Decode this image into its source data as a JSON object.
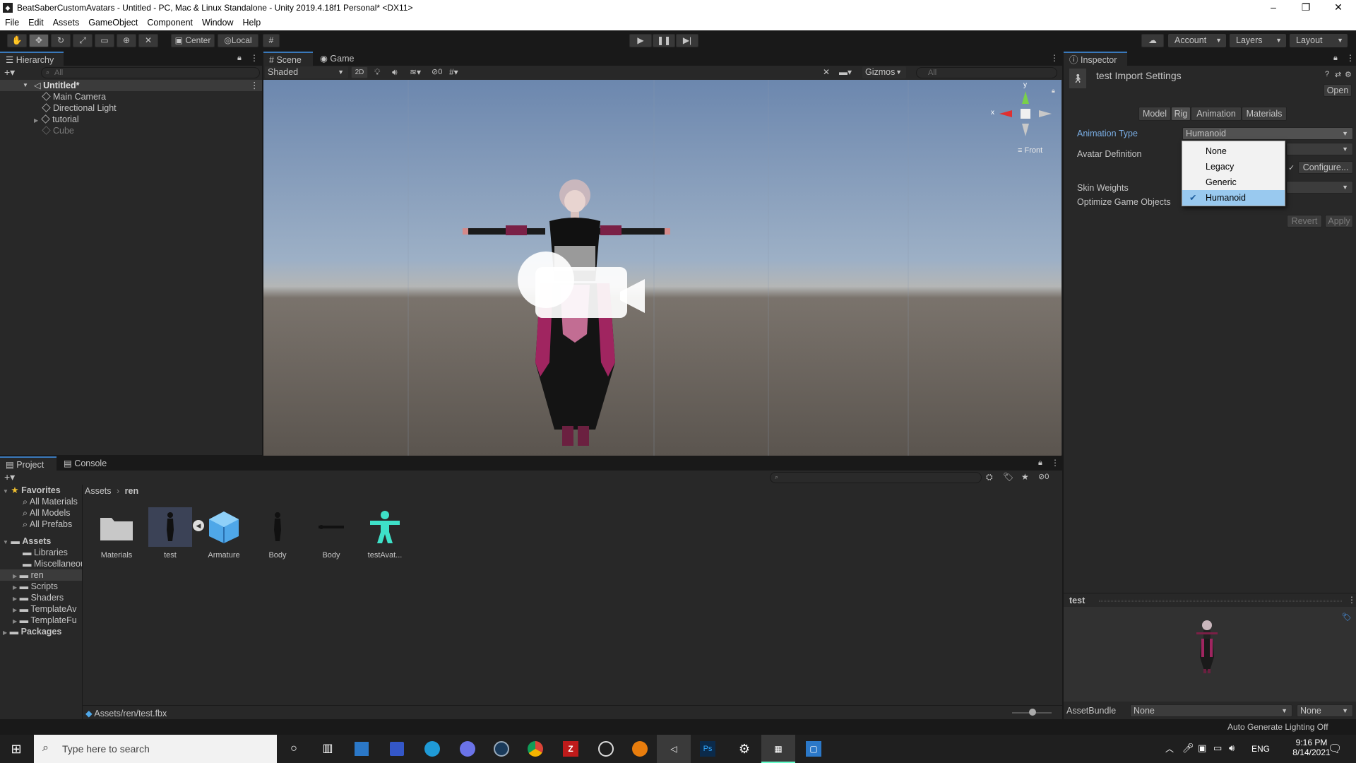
{
  "window": {
    "title": "BeatSaberCustomAvatars - Untitled - PC, Mac & Linux Standalone - Unity 2019.4.18f1 Personal* <DX11>",
    "minimize": "–",
    "restore": "❐",
    "close": "✕"
  },
  "menu": [
    "File",
    "Edit",
    "Assets",
    "GameObject",
    "Component",
    "Window",
    "Help"
  ],
  "toolbar": {
    "pivot": "Center",
    "space": "Local",
    "account": "Account",
    "layers": "Layers",
    "layout": "Layout"
  },
  "hierarchy": {
    "tab": "Hierarchy",
    "search_placeholder": "All",
    "scene": "Untitled*",
    "items": [
      {
        "label": "Main Camera",
        "active": true
      },
      {
        "label": "Directional Light",
        "active": true
      },
      {
        "label": "tutorial",
        "active": true
      },
      {
        "label": "Cube",
        "active": false
      }
    ]
  },
  "scene_view": {
    "tabs": [
      "Scene",
      "Game"
    ],
    "shading": "Shaded",
    "mode_2d": "2D",
    "hidden_count": "0",
    "gizmos": "Gizmos",
    "search_placeholder": "All",
    "gizmo_axis_y": "y",
    "gizmo_axis_x": "x",
    "view_label": "Front"
  },
  "inspector": {
    "tab": "Inspector",
    "title": "test Import Settings",
    "open": "Open",
    "subtabs": [
      "Model",
      "Rig",
      "Animation",
      "Materials"
    ],
    "active_subtab": "Rig",
    "fields": {
      "animation_type_label": "Animation Type",
      "animation_type_value": "Humanoid",
      "avatar_definition_label": "Avatar Definition",
      "configure": "Configure...",
      "skin_weights_label": "Skin Weights",
      "optimize_label": "Optimize Game Objects"
    },
    "dropdown_options": [
      "None",
      "Legacy",
      "Generic",
      "Humanoid"
    ],
    "dropdown_selected": "Humanoid",
    "revert": "Revert",
    "apply": "Apply",
    "preview_title": "test",
    "assetbundle_label": "AssetBundle",
    "assetbundle_value": "None",
    "assetbundle_variant": "None"
  },
  "project": {
    "tabs": [
      "Project",
      "Console"
    ],
    "hidden_count": "0",
    "favorites": {
      "label": "Favorites",
      "items": [
        "All Materials",
        "All Models",
        "All Prefabs"
      ]
    },
    "assets": {
      "label": "Assets",
      "items": [
        "Libraries",
        "Miscellaneous",
        "ren",
        "Scripts",
        "Shaders",
        "TemplateAv",
        "TemplateFu"
      ]
    },
    "packages": "Packages",
    "breadcrumb": [
      "Assets",
      "ren"
    ],
    "files": [
      {
        "name": "Materials",
        "kind": "folder"
      },
      {
        "name": "test",
        "kind": "model"
      },
      {
        "name": "Armature",
        "kind": "prefab"
      },
      {
        "name": "Body",
        "kind": "mesh"
      },
      {
        "name": "Body",
        "kind": "mesh-flat"
      },
      {
        "name": "testAvat...",
        "kind": "avatar"
      }
    ],
    "selected_path": "Assets/ren/test.fbx"
  },
  "status": {
    "lighting": "Auto Generate Lighting Off"
  },
  "taskbar": {
    "search_placeholder": "Type here to search",
    "lang": "ENG",
    "time": "9:16 PM",
    "date": "8/14/2021",
    "apps": [
      "cortana-icon",
      "task-view-icon",
      "store-icon",
      "save-icon",
      "edge-icon",
      "discord-icon",
      "steam-icon",
      "chrome-icon",
      "filezilla-icon",
      "obs-icon",
      "blender-icon",
      "visual-studio-icon",
      "photoshop-icon",
      "settings-icon",
      "unity-hub-icon",
      "unity-icon"
    ]
  },
  "colors": {
    "accent": "#3a79bb",
    "panel": "#282828",
    "dark": "#191919",
    "field_label_blue": "#7bafe6",
    "sky_top": "#6e88ae",
    "ground": "#5e5750"
  }
}
